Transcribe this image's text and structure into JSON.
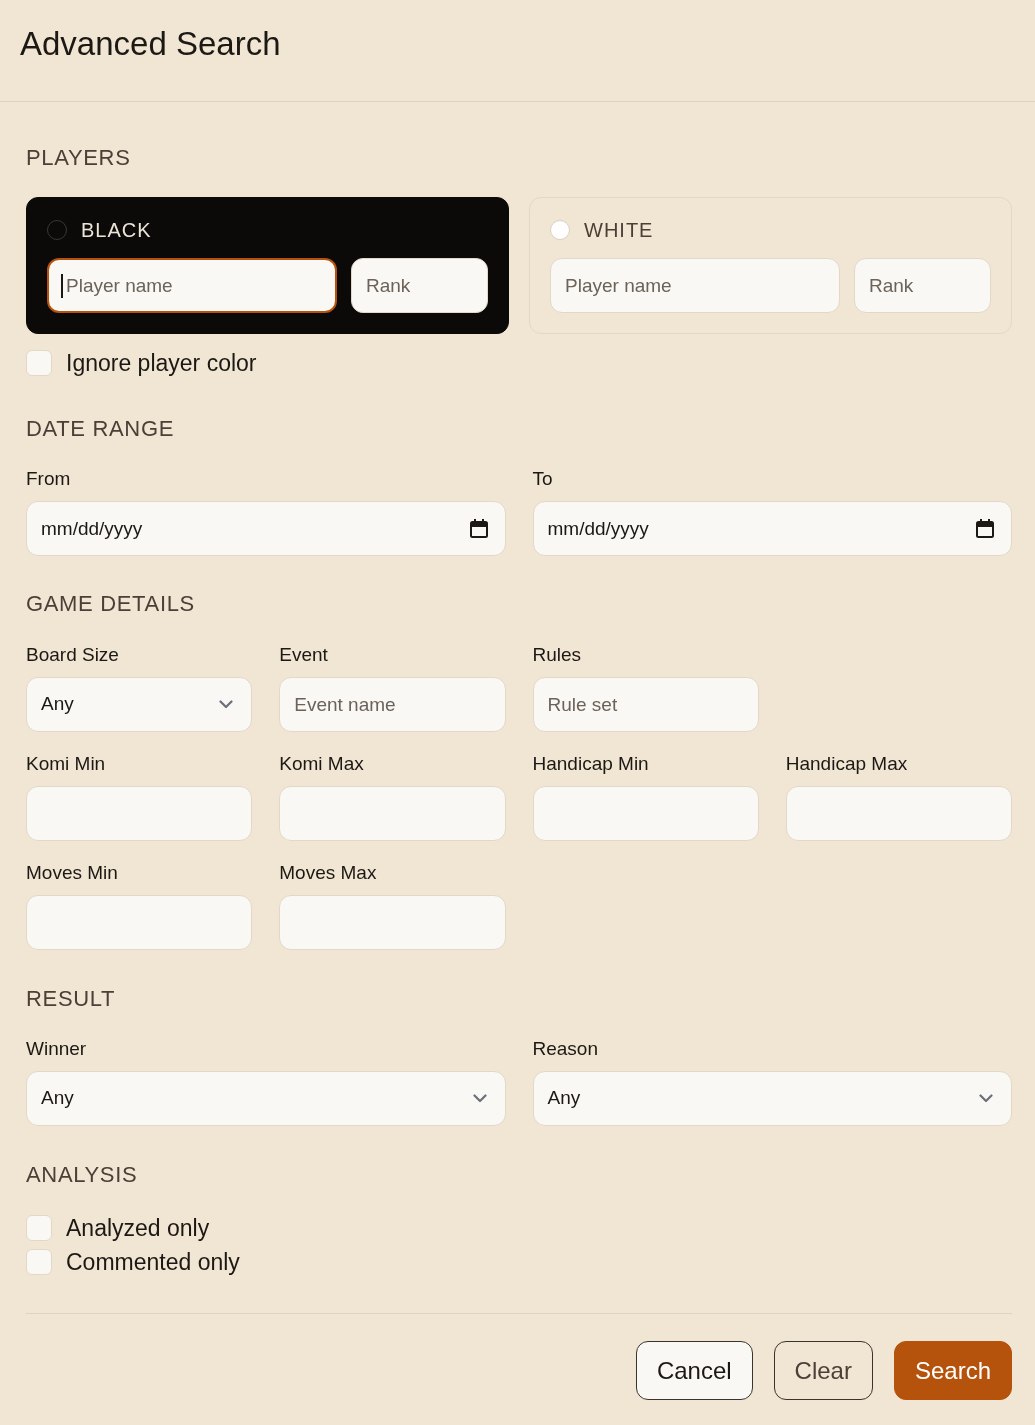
{
  "dialog": {
    "title": "Advanced Search"
  },
  "players": {
    "heading": "PLAYERS",
    "cards": [
      {
        "label": "BLACK",
        "selected": true,
        "color": "#0c0a08",
        "fields": [
          {
            "placeholder": "Player name",
            "focused": true
          },
          {
            "placeholder": "Rank",
            "focused": false
          }
        ]
      },
      {
        "label": "WHITE",
        "selected": false,
        "color": "#ffffff",
        "fields": [
          {
            "placeholder": "Player name",
            "focused": false
          },
          {
            "placeholder": "Rank",
            "focused": false
          }
        ]
      }
    ],
    "ignore_color": {
      "label": "Ignore player color",
      "checked": false
    }
  },
  "date_range": {
    "heading": "DATE RANGE",
    "fields": [
      {
        "label": "From",
        "placeholder": "mm/dd/yyyy"
      },
      {
        "label": "To",
        "placeholder": "mm/dd/yyyy"
      }
    ]
  },
  "game_details": {
    "heading": "GAME DETAILS",
    "rows": [
      [
        {
          "kind": "select",
          "label": "Board Size",
          "value": "Any"
        },
        {
          "kind": "text",
          "label": "Event",
          "placeholder": "Event name"
        },
        {
          "kind": "text",
          "label": "Rules",
          "placeholder": "Rule set"
        }
      ],
      [
        {
          "kind": "text",
          "label": "Komi Min"
        },
        {
          "kind": "text",
          "label": "Komi Max"
        },
        {
          "kind": "text",
          "label": "Handicap Min"
        },
        {
          "kind": "text",
          "label": "Handicap Max"
        }
      ],
      [
        {
          "kind": "text",
          "label": "Moves Min"
        },
        {
          "kind": "text",
          "label": "Moves Max"
        }
      ]
    ]
  },
  "result": {
    "heading": "RESULT",
    "fields": [
      {
        "kind": "select",
        "label": "Winner",
        "value": "Any"
      },
      {
        "kind": "select",
        "label": "Reason",
        "value": "Any"
      }
    ]
  },
  "analysis": {
    "heading": "ANALYSIS",
    "options": [
      {
        "label": "Analyzed only",
        "checked": false
      },
      {
        "label": "Commented only",
        "checked": false
      }
    ]
  },
  "buttons": [
    {
      "label": "Cancel",
      "kind": "secondary"
    },
    {
      "label": "Clear",
      "kind": "outline"
    },
    {
      "label": "Search",
      "kind": "primary"
    }
  ]
}
